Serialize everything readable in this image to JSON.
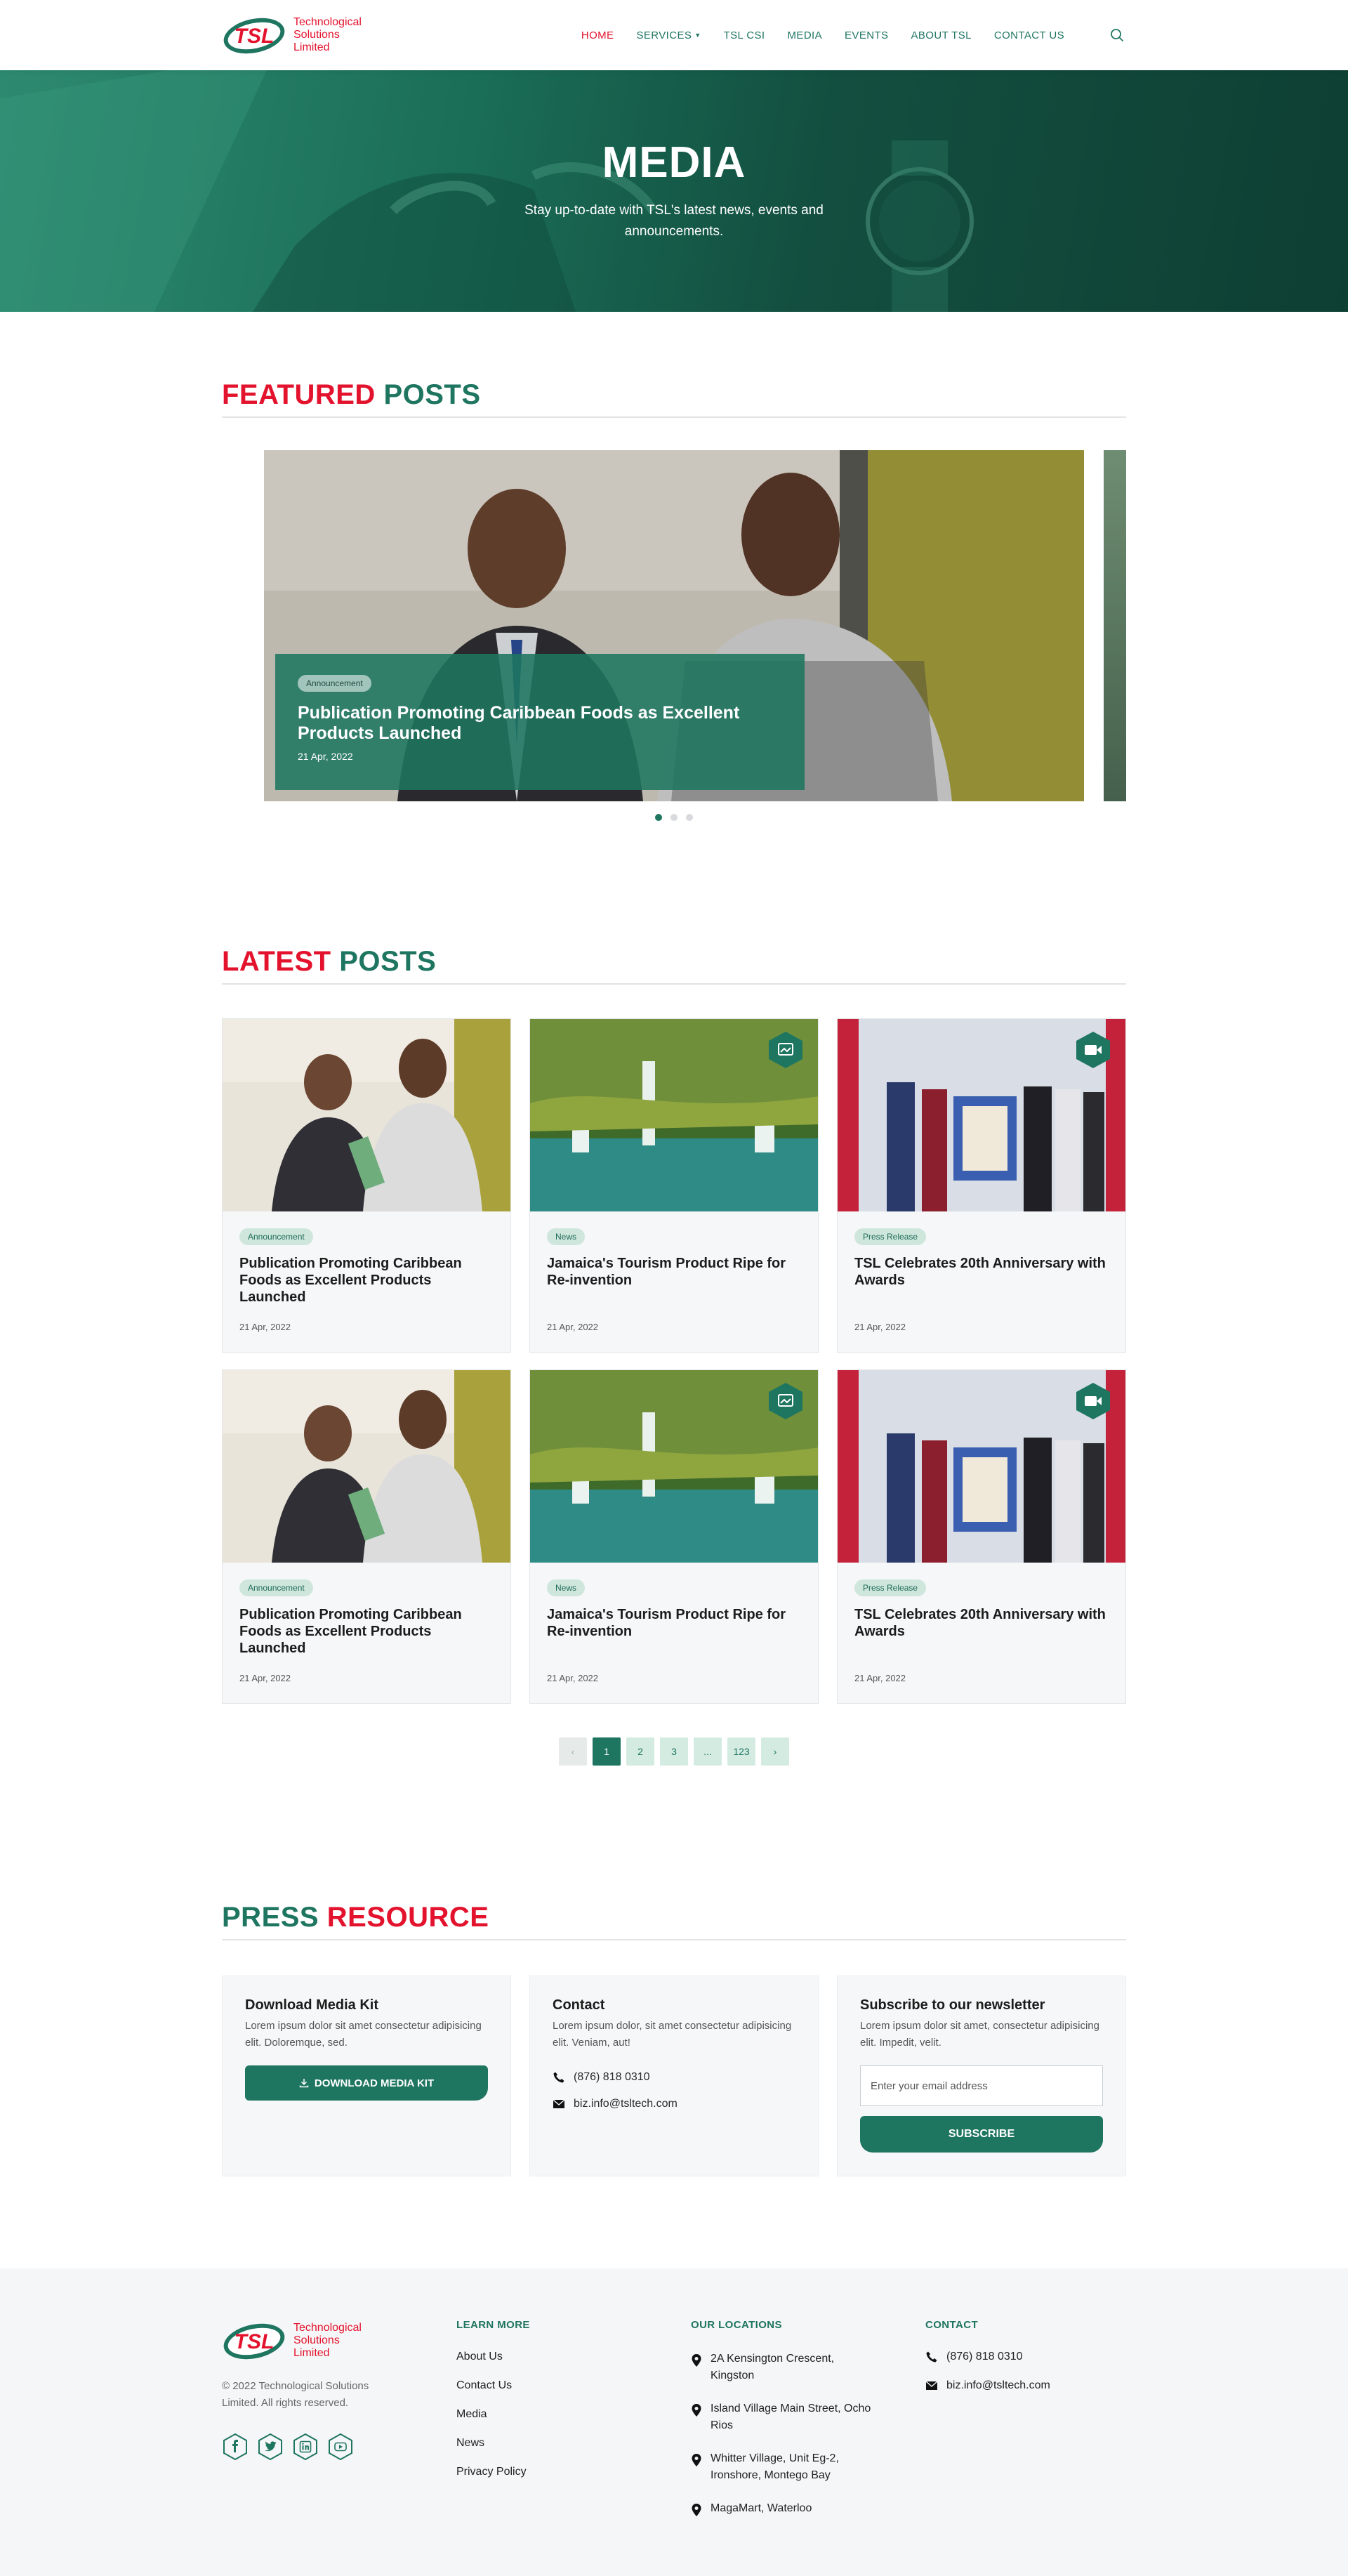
{
  "header": {
    "logo_text_line1": "Technological",
    "logo_text_line2": "Solutions",
    "logo_text_line3": "Limited",
    "nav": {
      "home": "HOME",
      "services": "SERVICES",
      "tsl_csi": "TSL CSI",
      "media": "MEDIA",
      "events": "EVENTS",
      "about": "ABOUT TSL",
      "contact": "CONTACT US"
    }
  },
  "hero": {
    "title": "MEDIA",
    "subtitle_line1": "Stay up-to-date with TSL's latest news, events and",
    "subtitle_line2": "announcements."
  },
  "featured": {
    "title_a": "FEATURED",
    "title_b": "POSTS",
    "slide": {
      "badge": "Announcement",
      "title_line1": "Publication Promoting Caribbean Foods as Excellent",
      "title_line2": "Products Launched",
      "date": "21 Apr, 2022"
    }
  },
  "latest": {
    "title_a": "LATEST",
    "title_b": "POSTS",
    "cards": [
      {
        "badge": "Announcement",
        "title": "Publication Promoting Caribbean Foods as Excellent Products Launched",
        "date": "21 Apr, 2022"
      },
      {
        "badge": "News",
        "title": "Jamaica's Tourism Product Ripe for Re-invention",
        "date": "21 Apr, 2022"
      },
      {
        "badge": "Press Release",
        "title": "TSL Celebrates 20th Anniversary with Awards",
        "date": "21 Apr, 2022"
      },
      {
        "badge": "Announcement",
        "title": "Publication Promoting Caribbean Foods as Excellent Products Launched",
        "date": "21 Apr, 2022"
      },
      {
        "badge": "News",
        "title": "Jamaica's Tourism Product Ripe for Re-invention",
        "date": "21 Apr, 2022"
      },
      {
        "badge": "Press Release",
        "title": "TSL Celebrates 20th Anniversary with Awards",
        "date": "21 Apr, 2022"
      }
    ],
    "pagination": [
      "1",
      "2",
      "3",
      "...",
      "123"
    ]
  },
  "press": {
    "title_a": "PRESS",
    "title_b": "RESOURCE",
    "media_kit": {
      "title": "Download Media Kit",
      "text": "Lorem ipsum dolor sit amet consectetur adipisicing elit. Doloremque, sed.",
      "button": "DOWNLOAD MEDIA KIT"
    },
    "contact": {
      "title": "Contact",
      "text": "Lorem ipsum dolor, sit amet consectetur adipisicing elit. Veniam, aut!",
      "phone": "(876) 818 0310",
      "email": "biz.info@tsltech.com"
    },
    "newsletter": {
      "title": "Subscribe to our newsletter",
      "text": "Lorem ipsum dolor sit amet, consectetur adipisicing elit. Impedit, velit.",
      "placeholder": "Enter your email address",
      "button": "SUBSCRIBE"
    }
  },
  "footer": {
    "copyright": "© 2022 Technological Solutions Limited. All rights reserved.",
    "learn_more": {
      "heading": "LEARN MORE",
      "links": [
        "About Us",
        "Contact Us",
        "Media",
        "News",
        "Privacy Policy"
      ]
    },
    "locations": {
      "heading": "OUR LOCATIONS",
      "items": [
        "2A Kensington Crescent, Kingston",
        "Island Village Main Street, Ocho Rios",
        "Whitter Village, Unit Eg-2, Ironshore, Montego Bay",
        "MagaMart, Waterloo"
      ]
    },
    "contact": {
      "heading": "CONTACT",
      "phone": "(876) 818 0310",
      "email": "biz.info@tsltech.com"
    }
  },
  "colors": {
    "brand_green": "#1e7560",
    "brand_red": "#e3122d",
    "light_green": "#cfe6dd"
  },
  "icons": {
    "search": "search-icon",
    "gallery": "gallery-icon",
    "video": "video-icon",
    "phone": "phone-icon",
    "email": "email-icon",
    "pin": "map-pin-icon",
    "download": "download-icon"
  }
}
